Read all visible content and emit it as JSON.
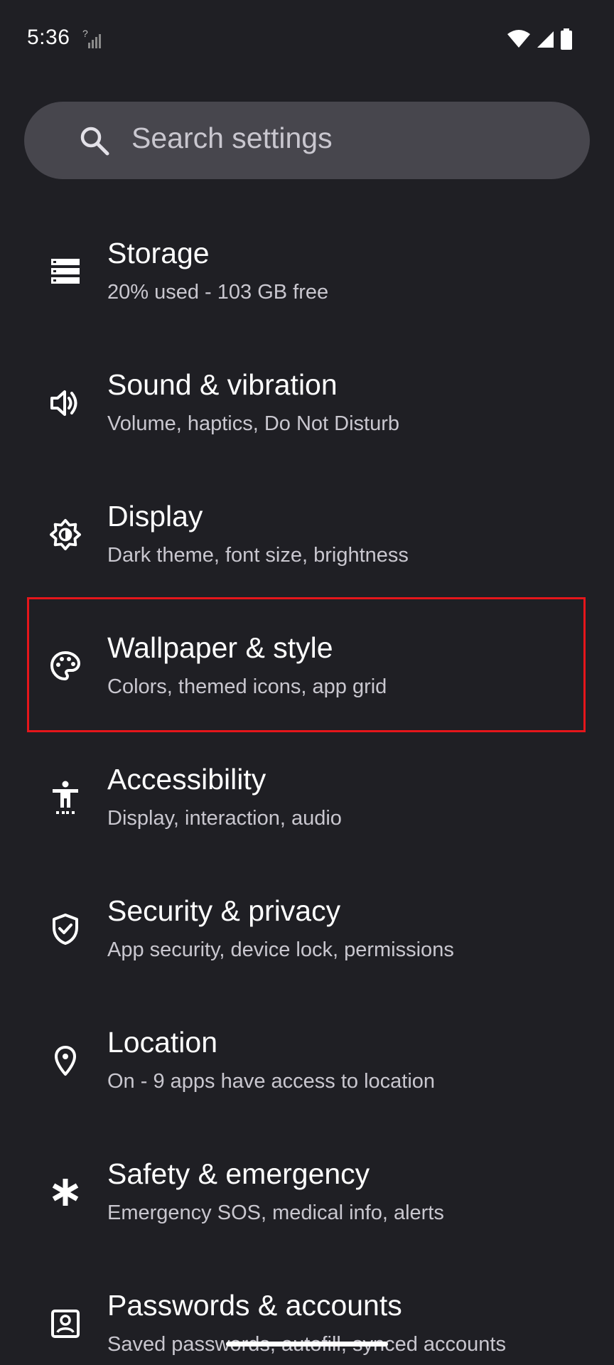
{
  "status_bar": {
    "time": "5:36",
    "icons": [
      "no-sim-icon",
      "wifi-icon",
      "cell-signal-icon",
      "battery-icon"
    ]
  },
  "search": {
    "placeholder": "Search settings",
    "icon": "search-icon"
  },
  "settings_items": [
    {
      "title": "Storage",
      "subtitle": "20% used - 103 GB free",
      "icon": "storage-icon"
    },
    {
      "title": "Sound & vibration",
      "subtitle": "Volume, haptics, Do Not Disturb",
      "icon": "volume-icon"
    },
    {
      "title": "Display",
      "subtitle": "Dark theme, font size, brightness",
      "icon": "brightness-icon"
    },
    {
      "title": "Wallpaper & style",
      "subtitle": "Colors, themed icons, app grid",
      "icon": "palette-icon",
      "highlighted": true
    },
    {
      "title": "Accessibility",
      "subtitle": "Display, interaction, audio",
      "icon": "accessibility-icon"
    },
    {
      "title": "Security & privacy",
      "subtitle": "App security, device lock, permissions",
      "icon": "shield-check-icon"
    },
    {
      "title": "Location",
      "subtitle": "On - 9 apps have access to location",
      "icon": "location-pin-icon"
    },
    {
      "title": "Safety & emergency",
      "subtitle": "Emergency SOS, medical info, alerts",
      "icon": "asterisk-icon"
    },
    {
      "title": "Passwords & accounts",
      "subtitle": "Saved passwords, autofill, synced accounts",
      "icon": "account-box-icon"
    }
  ],
  "colors": {
    "background": "#1f1f24",
    "search_bg": "#47464d",
    "title_text": "#ffffff",
    "subtitle_text": "#c9c7cf",
    "highlight_border": "#e5161b"
  }
}
